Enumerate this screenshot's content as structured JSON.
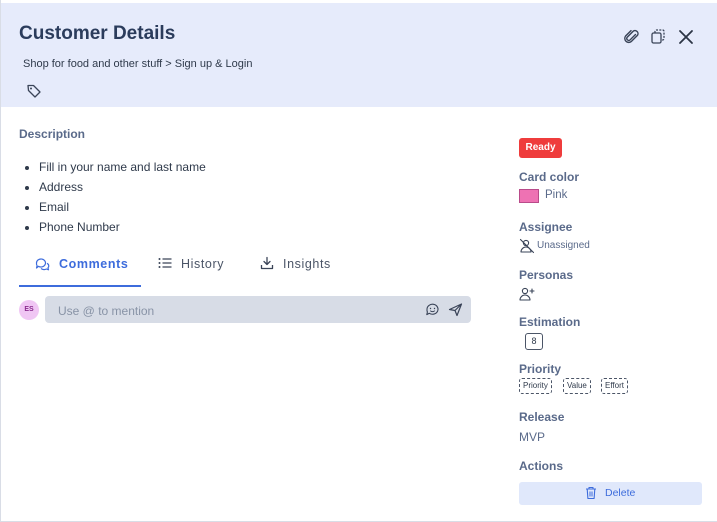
{
  "header": {
    "title": "Customer Details",
    "breadcrumb": "Shop for food and other stuff > Sign up & Login"
  },
  "description": {
    "label": "Description",
    "items": [
      "Fill in your name and last name",
      "Address",
      "Email",
      "Phone Number"
    ]
  },
  "tabs": [
    {
      "label": "Comments",
      "icon": "comments-icon",
      "active": true
    },
    {
      "label": "History",
      "icon": "list-icon",
      "active": false
    },
    {
      "label": "Insights",
      "icon": "download-icon",
      "active": false
    }
  ],
  "comment": {
    "avatar_initials": "ES",
    "placeholder": "Use @ to mention"
  },
  "sidebar": {
    "status": "Ready",
    "card_color_label": "Card color",
    "card_color_value": "Pink",
    "assignee_label": "Assignee",
    "assignee_value": "Unassigned",
    "personas_label": "Personas",
    "estimation_label": "Estimation",
    "estimation_value": "8",
    "priority_label": "Priority",
    "priority_chips": [
      "Priority",
      "Value",
      "Effort"
    ],
    "release_label": "Release",
    "release_value": "MVP",
    "actions_label": "Actions",
    "delete_label": "Delete"
  },
  "colors": {
    "header_bg": "#e6ebfb",
    "accent": "#3d6cdc",
    "ready": "#ef3c3c",
    "pink": "#ee72b3"
  }
}
